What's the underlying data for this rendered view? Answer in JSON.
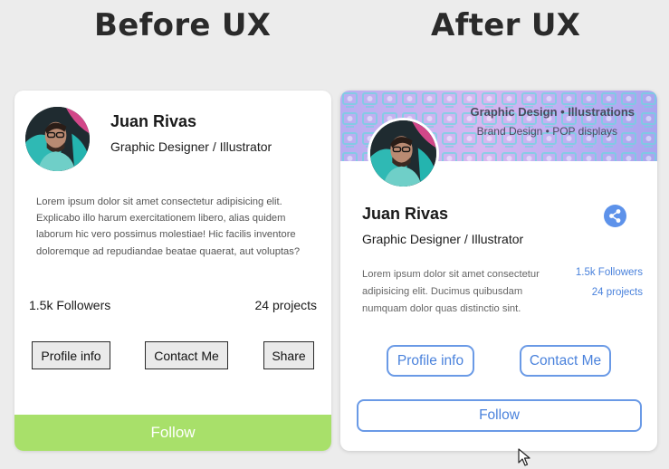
{
  "headings": {
    "before": "Before UX",
    "after": "After UX"
  },
  "before_card": {
    "name": "Juan Rivas",
    "title": "Graphic Designer / Illustrator",
    "bio": "Lorem ipsum dolor sit amet consectetur adipisicing elit. Explicabo illo harum exercitationem libero, alias quidem laborum hic vero possimus molestiae! Hic facilis inventore doloremque ad repudiandae beatae quaerat, aut voluptas?",
    "followers": "1.5k Followers",
    "projects": "24 projects",
    "buttons": {
      "profile": "Profile info",
      "contact": "Contact Me",
      "share": "Share"
    },
    "follow": "Follow",
    "colors": {
      "follow_bg": "#a8e06a"
    }
  },
  "after_card": {
    "banner_line1": "Graphic Design • Illustrations",
    "banner_line2": "Brand Design • POP displays",
    "name": "Juan Rivas",
    "title": "Graphic Designer / Illustrator",
    "bio": "Lorem ipsum dolor sit amet consectetur adipisicing elit. Ducimus quibusdam numquam dolor quas distinctio sint.",
    "followers": "1.5k Followers",
    "projects": "24 projects",
    "buttons": {
      "profile": "Profile info",
      "contact": "Contact Me"
    },
    "follow": "Follow",
    "share_icon": "share-icon",
    "colors": {
      "accent": "#4a82dc",
      "banner": "#d8b7f0"
    }
  }
}
